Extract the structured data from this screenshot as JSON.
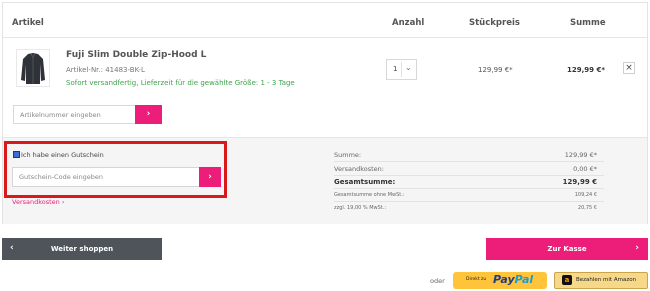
{
  "header": {
    "artikel": "Artikel",
    "anzahl": "Anzahl",
    "stueckpreis": "Stückpreis",
    "summe": "Summe"
  },
  "item": {
    "name": "Fuji Slim Double Zip-Hood L",
    "number": "Artikel-Nr.: 41483-BK-L",
    "shipping": "Sofort versandfertig, Lieferzeit für die gewählte Größe: 1 - 3 Tage",
    "quantity": "1",
    "unit_price": "129,99 €*",
    "total": "129,99 €*",
    "remove_icon": "close-icon",
    "thumbnail_icon": "jacket-image"
  },
  "add_article": {
    "placeholder": "Artikelnummer eingeben",
    "button_icon": "chevron-right-icon"
  },
  "voucher": {
    "checkbox_label": "Ich habe einen Gutschein",
    "checked": true,
    "placeholder": "Gutschein-Code eingeben",
    "button_icon": "chevron-right-icon"
  },
  "versandkosten_link": "Versandkosten ›",
  "totals": [
    {
      "label": "Summe:",
      "value": "129,99 €*"
    },
    {
      "label": "Versandkosten:",
      "value": "0,00 €*"
    },
    {
      "label": "Gesamtsumme:",
      "value": "129,99 €"
    },
    {
      "label": "Gesamtsumme ohne MwSt.:",
      "value": "109,24 €"
    },
    {
      "label": "zzgl. 19,00 % MwSt.:",
      "value": "20,75 €"
    }
  ],
  "buttons": {
    "continue": "Weiter shoppen",
    "checkout": "Zur Kasse",
    "left_arrow": "‹",
    "right_arrow": "›",
    "oder": "oder",
    "paypal_small": "Direkt zu",
    "paypal_logo_a": "Pay",
    "paypal_logo_b": "Pal",
    "amazon": "Bezahlen mit Amazon",
    "amazon_icon": "a"
  },
  "colors": {
    "accent": "#ec1e7a",
    "highlight": "#d91a1a",
    "dark_button": "#4e5459",
    "paypal": "#ffc439"
  }
}
